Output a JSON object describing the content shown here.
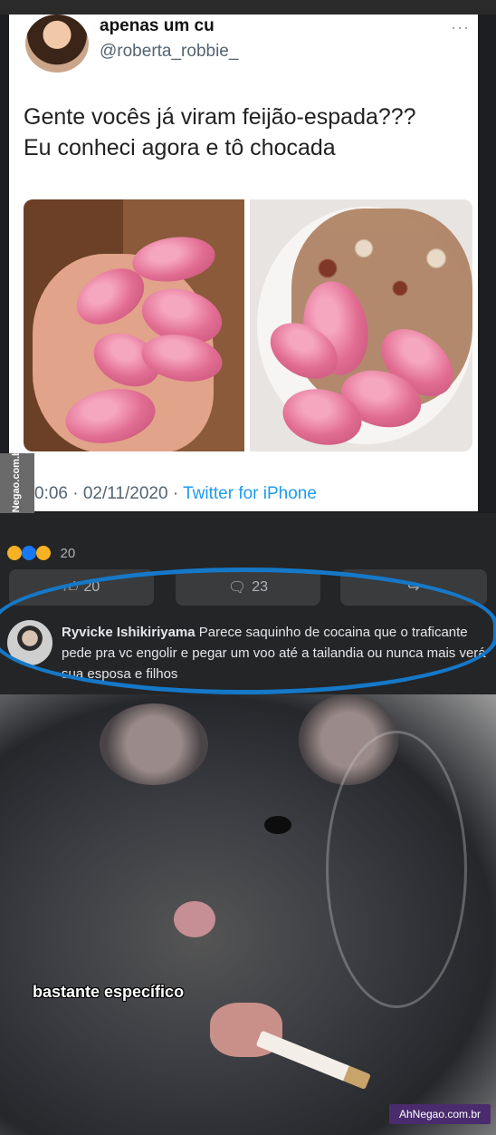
{
  "tweet": {
    "name": "apenas um cu",
    "handle": "@roberta_robbie_",
    "more": "···",
    "text_line1": "Gente vocês já viram feijão-espada???",
    "text_line2": "Eu conheci agora e tô chocada",
    "time": "0:06 · 02/11/2020 · ",
    "client": "Twitter for iPhone"
  },
  "watermark_side": "AhNegao.com.br",
  "facebook": {
    "reaction_count": "20",
    "like_count": "20",
    "comment_count": "23",
    "comment": {
      "author": "Ryvicke Ishikiriyama",
      "text": " Parece saquinho de cocaina que o traficante pede pra vc engolir e pegar um voo até a tailandia ou nunca mais verá sua esposa e filhos"
    },
    "accent_color": "#1578c8"
  },
  "meme": {
    "caption": "bastante específico",
    "watermark": "AhNegao.com.br"
  }
}
